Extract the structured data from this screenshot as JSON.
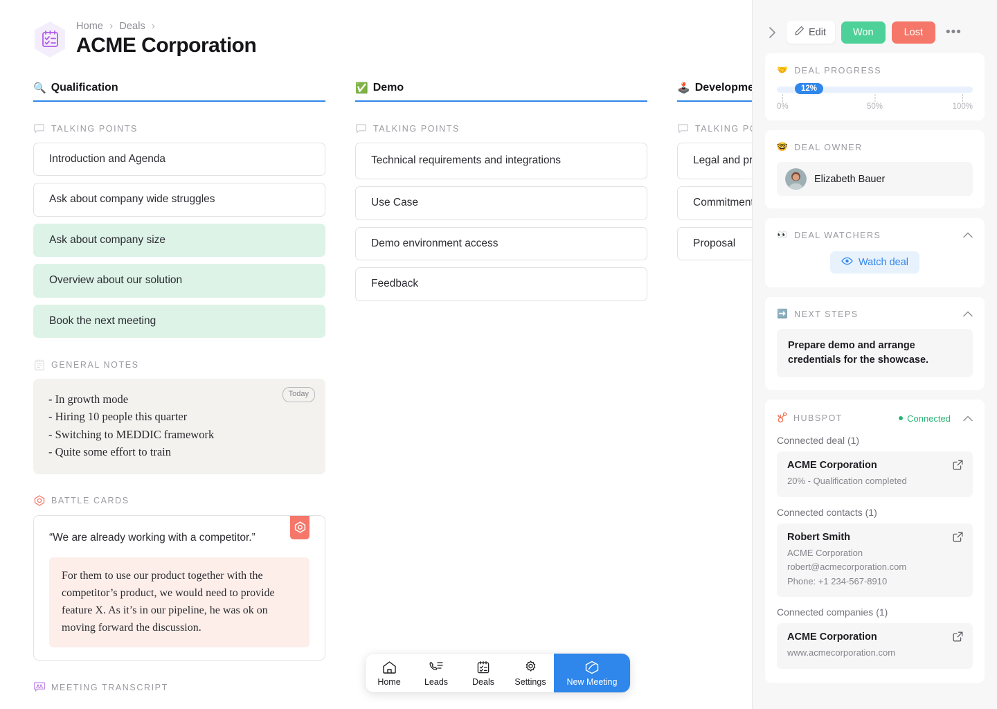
{
  "header": {
    "logo_icon": "clipboard-checklist-icon",
    "breadcrumb": {
      "home": "Home",
      "deals": "Deals",
      "separator": "›"
    },
    "title": "ACME Corporation"
  },
  "columns": [
    {
      "emoji": "🔍",
      "title": "Qualification",
      "talking_points_label": "TALKING POINTS",
      "talking_points": [
        {
          "text": "Introduction and Agenda",
          "done": false
        },
        {
          "text": "Ask about company wide struggles",
          "done": false
        },
        {
          "text": "Ask about company size",
          "done": true
        },
        {
          "text": "Overview about our solution",
          "done": true
        },
        {
          "text": "Book the next meeting",
          "done": true
        }
      ],
      "general_notes_label": "GENERAL NOTES",
      "general_notes_chip": "Today",
      "general_notes": [
        "- In growth mode",
        "- Hiring 10 people this quarter",
        "- Switching to MEDDIC framework",
        "- Quite some effort to train"
      ],
      "battle_cards_label": "BATTLE CARDS",
      "battle_card": {
        "quote": "“We are already working with a competitor.”",
        "body": "For them to use our product together with the competitor’s product, we would need to provide feature X. As it’s in our pipeline, he was ok on moving forward the discussion."
      },
      "meeting_transcript_label": "MEETING TRANSCRIPT"
    },
    {
      "emoji": "✅",
      "title": "Demo",
      "talking_points_label": "TALKING POINTS",
      "talking_points": [
        {
          "text": "Technical requirements and integrations",
          "done": false
        },
        {
          "text": "Use Case",
          "done": false
        },
        {
          "text": "Demo environment access",
          "done": false
        },
        {
          "text": "Feedback",
          "done": false
        }
      ]
    },
    {
      "emoji": "🕹️",
      "title": "Development",
      "talking_points_label": "TALKING POINTS",
      "talking_points": [
        {
          "text": "Legal and procurement requirements",
          "done": false
        },
        {
          "text": "Commitment",
          "done": false
        },
        {
          "text": "Proposal",
          "done": false
        }
      ]
    }
  ],
  "navbar": [
    {
      "label": "Home",
      "icon": "home-icon",
      "primary": false
    },
    {
      "label": "Leads",
      "icon": "phone-list-icon",
      "primary": false
    },
    {
      "label": "Deals",
      "icon": "clipboard-checklist-icon",
      "primary": false
    },
    {
      "label": "Settings",
      "icon": "gear-icon",
      "primary": false
    },
    {
      "label": "New Meeting",
      "icon": "meeting-hex-icon",
      "primary": true
    }
  ],
  "panel": {
    "collapse_icon": "chevron-right-icon",
    "edit_label": "Edit",
    "edit_icon": "pencil-icon",
    "won_label": "Won",
    "lost_label": "Lost",
    "more_label": "•••",
    "colors": {
      "won": "#4ed198",
      "lost": "#f5776a",
      "accent": "#2f86eb",
      "connected": "#29b573"
    },
    "deal_progress": {
      "emoji": "🤝",
      "title": "DEAL PROGRESS",
      "value": "12%",
      "percent": 12,
      "ticks": [
        "0%",
        "50%",
        "100%"
      ]
    },
    "deal_owner": {
      "emoji": "🤓",
      "title": "DEAL OWNER",
      "name": "Elizabeth Bauer"
    },
    "deal_watchers": {
      "emoji": "👀",
      "title": "DEAL WATCHERS",
      "watch_label": "Watch deal",
      "watch_icon": "eye-icon",
      "collapse_icon": "chevron-up-icon"
    },
    "next_steps": {
      "emoji": "➡️",
      "title": "NEXT STEPS",
      "text": "Prepare demo and arrange credentials for the showcase.",
      "collapse_icon": "chevron-up-icon"
    },
    "hubspot": {
      "icon": "hubspot-icon",
      "title": "HUBSPOT",
      "status": "Connected",
      "collapse_icon": "chevron-up-icon",
      "deal_group_label": "Connected deal (1)",
      "deal": {
        "name": "ACME Corporation",
        "sub": "20% - Qualification completed"
      },
      "contacts_group_label": "Connected contacts (1)",
      "contact": {
        "name": "Robert Smith",
        "company": "ACME Corporation",
        "email": "robert@acmecorporation.com",
        "phone": "Phone: +1 234-567-8910"
      },
      "companies_group_label": "Connected companies (1)",
      "company": {
        "name": "ACME Corporation",
        "website": "www.acmecorporation.com"
      }
    }
  }
}
